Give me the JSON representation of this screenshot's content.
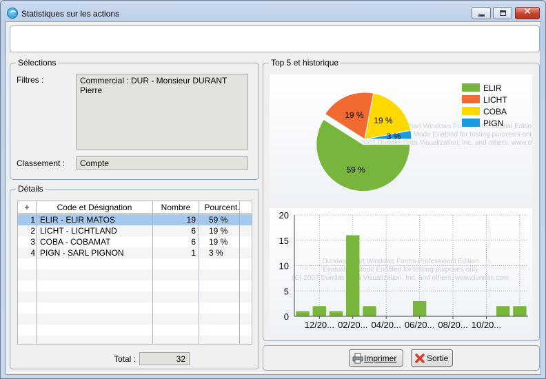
{
  "window": {
    "title": "Statistiques sur les actions",
    "icon": "app-logo-icon"
  },
  "selections": {
    "label": "Sélections",
    "filtres_label": "Filtres :",
    "filtres_value": "Commercial : DUR - Monsieur DURANT Pierre",
    "classement_label": "Classement :",
    "classement_value": "Compte"
  },
  "details": {
    "label": "Détails",
    "columns": [
      "Code et Désignation",
      "Nombre",
      "Pourcent."
    ],
    "add_glyph": "+",
    "rows": [
      {
        "idx": "1",
        "designation": "ELIR - ELIR MATOS",
        "nombre": "19",
        "pourcent": "59 %"
      },
      {
        "idx": "2",
        "designation": "LICHT - LICHTLAND",
        "nombre": "6",
        "pourcent": "19 %"
      },
      {
        "idx": "3",
        "designation": "COBA - COBAMAT",
        "nombre": "6",
        "pourcent": "19 %"
      },
      {
        "idx": "4",
        "designation": "PIGN - SARL PIGNON",
        "nombre": "1",
        "pourcent": "3 %"
      }
    ],
    "total_label": "Total :",
    "total_value": "32"
  },
  "top5": {
    "label": "Top 5 et historique"
  },
  "watermark": {
    "line1": "Dundas Chart Windows Forms Professional Edition",
    "line2": "Evaluation Mode Enabled for testing purposes only",
    "line3": "(C) 2007 Dundas Data Visualization, Inc. and others. www.dundas.com"
  },
  "buttons": {
    "imprimer": "Imprimer",
    "sortie": "Sortie"
  },
  "colors": {
    "elir": "#77b53c",
    "licht": "#f16a31",
    "coba": "#ffd800",
    "pign": "#1a9ae0",
    "bar": "#77b53c"
  },
  "chart_data": [
    {
      "type": "pie",
      "slices": [
        {
          "name": "ELIR",
          "value": 59,
          "label": "59 %"
        },
        {
          "name": "LICHT",
          "value": 19,
          "label": "19 %"
        },
        {
          "name": "COBA",
          "value": 19,
          "label": "19 %"
        },
        {
          "name": "PIGN",
          "value": 3,
          "label": "3 %"
        }
      ],
      "legend": [
        "ELIR",
        "LICHT",
        "COBA",
        "PIGN"
      ],
      "legend_position": "top-right",
      "exploded_slice": "ELIR"
    },
    {
      "type": "bar",
      "values": [
        1,
        2,
        1,
        16,
        2,
        0,
        0,
        3,
        0,
        0,
        0,
        0,
        2,
        2
      ],
      "x_tick_labels": [
        "12/20...",
        "02/20...",
        "04/20...",
        "06/20...",
        "08/20...",
        "10/20..."
      ],
      "ylim": [
        0,
        20
      ],
      "y_ticks": [
        0,
        5,
        10,
        15,
        20
      ],
      "grid": true
    }
  ]
}
